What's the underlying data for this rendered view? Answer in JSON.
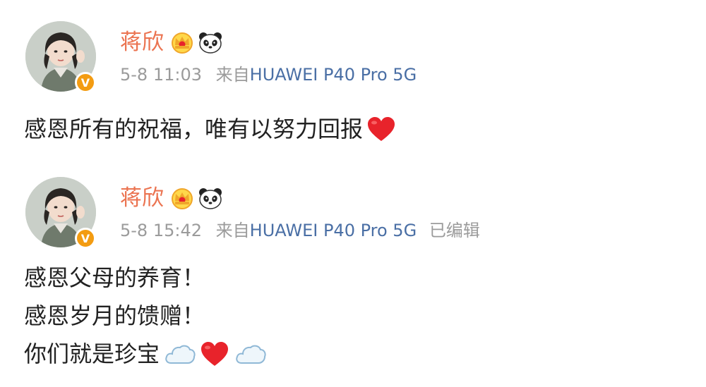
{
  "posts": [
    {
      "username": "蒋欣",
      "time": "5-8 11:03",
      "source_prefix": "来自",
      "device": "HUAWEI P40 Pro 5G",
      "edited": "",
      "lines": [
        "感恩所有的祝福，唯有以努力回报"
      ],
      "emojis": [
        "heart-icon"
      ]
    },
    {
      "username": "蒋欣",
      "time": "5-8 15:42",
      "source_prefix": "来自",
      "device": "HUAWEI P40 Pro 5G",
      "edited": "已编辑",
      "lines": [
        "感恩父母的养育！",
        "感恩岁月的馈赠！",
        "你们就是珍宝"
      ],
      "emojis": [
        "cloud-icon",
        "heart-icon",
        "cloud-icon"
      ]
    }
  ],
  "badge": {
    "verified_letter": "V"
  },
  "colors": {
    "username": "#eb7350",
    "device_link": "#4a6fa5",
    "meta_text": "#9b9b9b",
    "heart": "#e8232b",
    "badge": "#f39c12"
  }
}
